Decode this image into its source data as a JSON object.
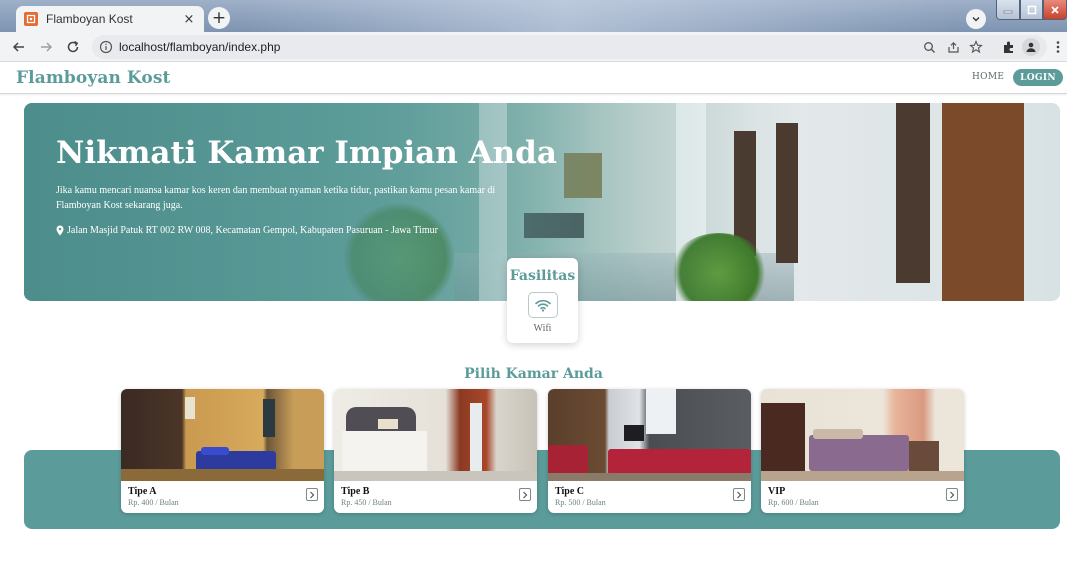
{
  "browser": {
    "tab_title": "Flamboyan Kost",
    "tab_close": "×",
    "new_tab": "+",
    "url": "localhost/flamboyan/index.php"
  },
  "navbar": {
    "brand": "Flamboyan Kost",
    "home": "HOME",
    "login": "LOGIN"
  },
  "hero": {
    "title": "Nikmati Kamar Impian Anda",
    "description": "Jika kamu mencari nuansa kamar kos keren dan membuat nyaman ketika tidur, pastikan kamu pesan kamar di Flamboyan Kost sekarang juga.",
    "address": "Jalan Masjid Patuk RT 002 RW 008, Kecamatan Gempol, Kabupaten Pasuruan - Jawa Timur"
  },
  "facilities": {
    "title": "Fasilitas",
    "items": [
      {
        "label": "Wifi",
        "icon": "wifi-icon"
      }
    ]
  },
  "rooms": {
    "title": "Pilih Kamar Anda",
    "items": [
      {
        "name": "Tipe A",
        "price": "Rp. 400 / Bulan"
      },
      {
        "name": "Tipe B",
        "price": "Rp. 450 / Bulan"
      },
      {
        "name": "Tipe C",
        "price": "Rp. 500 / Bulan"
      },
      {
        "name": "VIP",
        "price": "Rp. 600 / Bulan"
      }
    ]
  },
  "colors": {
    "accent": "#5b9c9b",
    "navbar_bg": "#ffffff",
    "login_text": "#ffffff"
  }
}
